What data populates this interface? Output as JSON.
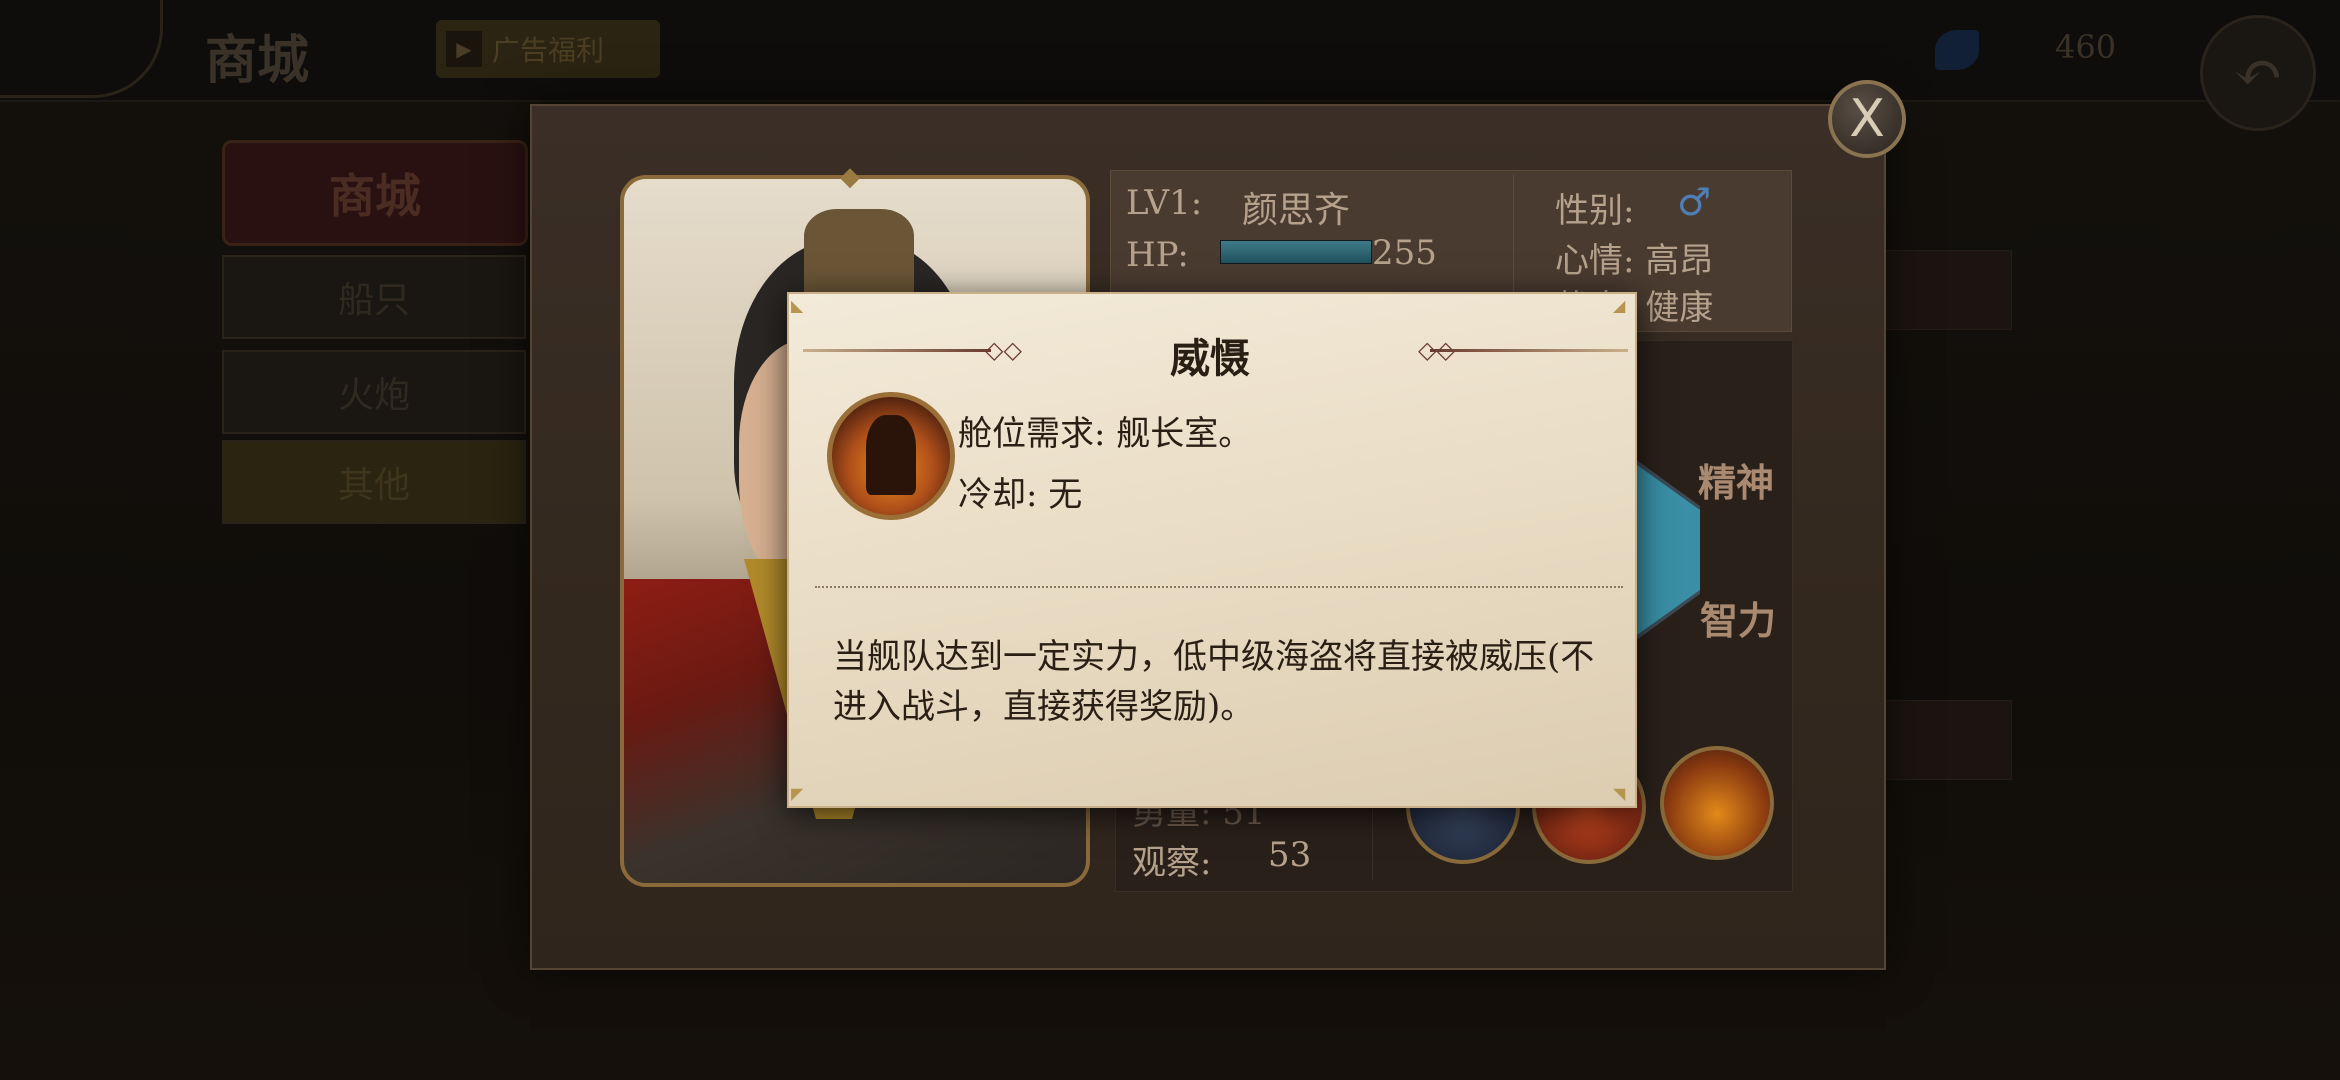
{
  "background": {
    "title": "商城",
    "ad_button": "广告福利",
    "gem_count": "460",
    "side_header": "商城",
    "side_tabs": [
      "船只",
      "火炮",
      "其他"
    ]
  },
  "character": {
    "level_label": "LV1:",
    "name": "颜思齐",
    "hp_label": "HP:",
    "hp_value": "255",
    "hp_ratio": 1.0,
    "gender_label": "性别:",
    "gender_icon": "male-icon",
    "gender_color": "#4d7fb5",
    "mood": "心情: 高昂",
    "status": "状态: 健康",
    "stats": {
      "jingshen": "精神",
      "zhili": "智力",
      "hidden_row": "勇量: 51",
      "observe_label": "观察:",
      "observe_value": "53"
    }
  },
  "popup": {
    "title": "威慑",
    "requirement": "舱位需求: 舰长室。",
    "cooldown": "冷却: 无",
    "description": "当舰队达到一定实力，低中级海盗将直接被威压(不进入战斗，直接获得奖励)。"
  },
  "close_label": "X"
}
